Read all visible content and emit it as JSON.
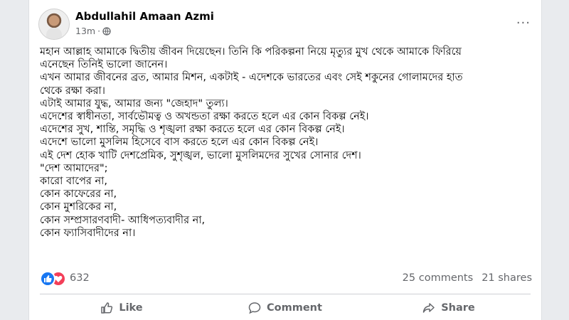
{
  "post": {
    "author": "Abdullahil Amaan Azmi",
    "time": "13m",
    "more_label": "···",
    "lines": [
      "মহান আল্লাহ আমাকে দ্বিতীয় জীবন দিয়েছেন। তিনি কি পরিকল্পনা নিয়ে মৃত্যুর মুখ থেকে আমাকে ফিরিয়ে",
      "এনেছেন তিনিই ভালো জানেন।",
      "এখন আমার জীবনের ব্রত, আমার মিশন, একটাই - এদেশকে ভারতের এবং সেই শকুনের গোলামদের হাত",
      "থেকে রক্ষা করা।",
      "এটাই আমার যুদ্ধ, আমার জন্য \"জেহাদ\" তুল্য।",
      "এদেশের স্বাধীনতা, সার্বভৌমত্ব ও অখন্ডতা রক্ষা করতে হলে এর কোন বিকল্প নেই।",
      "এদেশের সুখ, শান্তি, সমৃদ্ধি ও শৃঙ্খলা রক্ষা করতে হলে এর কোন বিকল্প নেই।",
      "এদেশে ভালো মুসলিম হিসেবে বাস করতে হলে এর কোন বিকল্প নেই।",
      "এই দেশ হোক খাটি দেশপ্রেমিক, সুশৃঙ্খল, ভালো মুসলিমদের সুখের সোনার দেশ।",
      "\"দেশ আমাদের\";",
      "কারো বাপের না,",
      "কোন কাফেরের না,",
      "কোন মুশরিকের না,",
      "কোন সম্প্রসারণবাদী- আধিপত্যবাদীর না,",
      "কোন ফ্যাসিবাদীদের না।"
    ]
  },
  "stats": {
    "reactions": "632",
    "comments": "25 comments",
    "shares": "21 shares"
  },
  "actions": {
    "like": "Like",
    "comment": "Comment",
    "share": "Share"
  },
  "colors": {
    "like_blue": "#1877f2",
    "love_red": "#f33e58",
    "meta_gray": "#65676b"
  }
}
